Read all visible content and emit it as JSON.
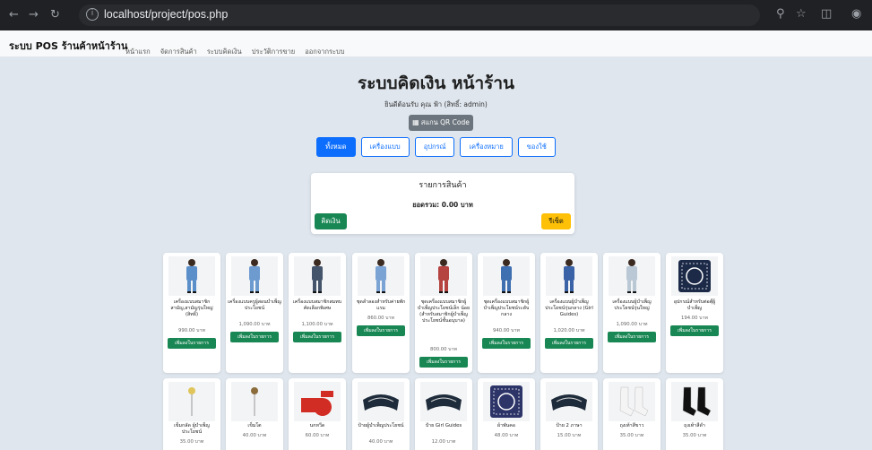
{
  "browser": {
    "url": "localhost/project/pos.php"
  },
  "navbar": {
    "brand": "ระบบ POS ร้านค้าหน้าร้าน",
    "links": [
      "หน้าแรก",
      "จัดการสินค้า",
      "ระบบคิดเงิน",
      "ประวัติการขาย",
      "ออกจากระบบ"
    ]
  },
  "header": {
    "title": "ระบบคิดเงิน หน้าร้าน",
    "welcome": "ยินดีต้อนรับ คุณ ฟ้า (สิทธิ์: admin)",
    "qr_label": "สแกน QR Code"
  },
  "categories": [
    {
      "label": "ทั้งหมด",
      "active": true
    },
    {
      "label": "เครื่องแบบ",
      "active": false
    },
    {
      "label": "อุปกรณ์",
      "active": false
    },
    {
      "label": "เครื่องหมาย",
      "active": false
    },
    {
      "label": "ของใช้",
      "active": false
    }
  ],
  "cart": {
    "title": "รายการสินค้า",
    "total": "ยอดรวม: 0.00 บาท",
    "checkout_label": "คิดเงิน",
    "reset_label": "รีเซ็ต"
  },
  "add_label": "เพิ่มลงในรายการ",
  "products": [
    {
      "name": "เครื่องแบบสมาชิกสามัญ,สามัญรุ่นใหญ่ (สิทธิ์)",
      "price": "990.00 บาท",
      "icon": "uniform-icon",
      "color": "#5b8fc9"
    },
    {
      "name": "เครื่องแบบครูผู้สอนบำเพ็ญประโยชน์",
      "price": "1,090.00 บาท",
      "icon": "uniform-icon",
      "color": "#6d9bd0"
    },
    {
      "name": "เครื่องแบบสมาชิกสมทบ คัดเลือกพิเศษ",
      "price": "1,100.00 บาท",
      "icon": "uniform-icon",
      "color": "#44556b"
    },
    {
      "name": "ชุดลำลองสำหรับค่ายพักแรม",
      "price": "860.00 บาท",
      "icon": "uniform-icon",
      "color": "#7ba3d4"
    },
    {
      "name": "ชุดเครื่องแบบสมาชิกผู้บำเพ็ญประโยชน์เล็ก น้อย (สำหรับสมาชิกผู้บำเพ็ญประโยชน์ชั้นอนุบาล)",
      "price": "800.00 บาท",
      "icon": "uniform-icon",
      "color": "#b54340"
    },
    {
      "name": "ชุดเครื่องแบบสมาชิกผู้บำเพ็ญประโยชน์ระดับ กลาง",
      "price": "940.00 บาท",
      "icon": "uniform-icon",
      "color": "#3e6fb0"
    },
    {
      "name": "เครื่องแบบผู้บำเพ็ญประโยชน์รุ่นกลาง (Girl Guides)",
      "price": "1,020.00 บาท",
      "icon": "uniform-icon",
      "color": "#3a62a6"
    },
    {
      "name": "เครื่องแบบผู้บำเพ็ญประโยชน์รุ่นใหญ่",
      "price": "1,090.00 บาท",
      "icon": "uniform-icon",
      "color": "#b9c8d4"
    },
    {
      "name": "อุปกรณ์สำหรับต่อตุ๊ผู้บำเพ็ญ",
      "price": "194.00 บาท",
      "icon": "scarf-icon",
      "color": "#1c2a48"
    },
    {
      "name": "เข็มกลัด ผู้บำเพ็ญประโยชน์",
      "price": "35.00 บาท",
      "icon": "pin-icon",
      "color": "#e0c55a"
    },
    {
      "name": "เข็มโต",
      "price": "40.00 บาท",
      "icon": "pin-icon",
      "color": "#8a6d3b"
    },
    {
      "name": "นกหวีด",
      "price": "60.00 บาท",
      "icon": "whistle-icon",
      "color": "#d22d24"
    },
    {
      "name": "ป้ายผู้บำเพ็ญประโยชน์",
      "price": "40.00 บาท",
      "icon": "patch-icon",
      "color": "#1e2b3a"
    },
    {
      "name": "ป้าย Girl Guides",
      "price": "12.00 บาท",
      "icon": "patch-icon",
      "color": "#1e2b3a"
    },
    {
      "name": "ผ้าพันคอ",
      "price": "48.00 บาท",
      "icon": "scarf-icon",
      "color": "#2c3468"
    },
    {
      "name": "ป้าย 2 ภาษา",
      "price": "15.00 บาท",
      "icon": "patch-icon",
      "color": "#1e2b3a"
    },
    {
      "name": "ถุงเท้าสีขาว",
      "price": "35.00 บาท",
      "icon": "socks-icon",
      "color": "#f4f4f4"
    },
    {
      "name": "ถุงเท้าสีดำ",
      "price": "35.00 บาท",
      "icon": "socks-icon",
      "color": "#111111"
    }
  ]
}
